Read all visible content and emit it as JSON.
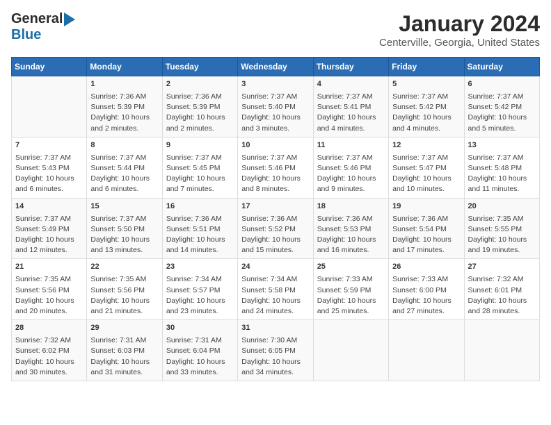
{
  "logo": {
    "general": "General",
    "blue": "Blue"
  },
  "title": "January 2024",
  "subtitle": "Centerville, Georgia, United States",
  "days_of_week": [
    "Sunday",
    "Monday",
    "Tuesday",
    "Wednesday",
    "Thursday",
    "Friday",
    "Saturday"
  ],
  "weeks": [
    [
      {
        "day": "",
        "content": ""
      },
      {
        "day": "1",
        "content": "Sunrise: 7:36 AM\nSunset: 5:39 PM\nDaylight: 10 hours\nand 2 minutes."
      },
      {
        "day": "2",
        "content": "Sunrise: 7:36 AM\nSunset: 5:39 PM\nDaylight: 10 hours\nand 2 minutes."
      },
      {
        "day": "3",
        "content": "Sunrise: 7:37 AM\nSunset: 5:40 PM\nDaylight: 10 hours\nand 3 minutes."
      },
      {
        "day": "4",
        "content": "Sunrise: 7:37 AM\nSunset: 5:41 PM\nDaylight: 10 hours\nand 4 minutes."
      },
      {
        "day": "5",
        "content": "Sunrise: 7:37 AM\nSunset: 5:42 PM\nDaylight: 10 hours\nand 4 minutes."
      },
      {
        "day": "6",
        "content": "Sunrise: 7:37 AM\nSunset: 5:42 PM\nDaylight: 10 hours\nand 5 minutes."
      }
    ],
    [
      {
        "day": "7",
        "content": "Sunrise: 7:37 AM\nSunset: 5:43 PM\nDaylight: 10 hours\nand 6 minutes."
      },
      {
        "day": "8",
        "content": "Sunrise: 7:37 AM\nSunset: 5:44 PM\nDaylight: 10 hours\nand 6 minutes."
      },
      {
        "day": "9",
        "content": "Sunrise: 7:37 AM\nSunset: 5:45 PM\nDaylight: 10 hours\nand 7 minutes."
      },
      {
        "day": "10",
        "content": "Sunrise: 7:37 AM\nSunset: 5:46 PM\nDaylight: 10 hours\nand 8 minutes."
      },
      {
        "day": "11",
        "content": "Sunrise: 7:37 AM\nSunset: 5:46 PM\nDaylight: 10 hours\nand 9 minutes."
      },
      {
        "day": "12",
        "content": "Sunrise: 7:37 AM\nSunset: 5:47 PM\nDaylight: 10 hours\nand 10 minutes."
      },
      {
        "day": "13",
        "content": "Sunrise: 7:37 AM\nSunset: 5:48 PM\nDaylight: 10 hours\nand 11 minutes."
      }
    ],
    [
      {
        "day": "14",
        "content": "Sunrise: 7:37 AM\nSunset: 5:49 PM\nDaylight: 10 hours\nand 12 minutes."
      },
      {
        "day": "15",
        "content": "Sunrise: 7:37 AM\nSunset: 5:50 PM\nDaylight: 10 hours\nand 13 minutes."
      },
      {
        "day": "16",
        "content": "Sunrise: 7:36 AM\nSunset: 5:51 PM\nDaylight: 10 hours\nand 14 minutes."
      },
      {
        "day": "17",
        "content": "Sunrise: 7:36 AM\nSunset: 5:52 PM\nDaylight: 10 hours\nand 15 minutes."
      },
      {
        "day": "18",
        "content": "Sunrise: 7:36 AM\nSunset: 5:53 PM\nDaylight: 10 hours\nand 16 minutes."
      },
      {
        "day": "19",
        "content": "Sunrise: 7:36 AM\nSunset: 5:54 PM\nDaylight: 10 hours\nand 17 minutes."
      },
      {
        "day": "20",
        "content": "Sunrise: 7:35 AM\nSunset: 5:55 PM\nDaylight: 10 hours\nand 19 minutes."
      }
    ],
    [
      {
        "day": "21",
        "content": "Sunrise: 7:35 AM\nSunset: 5:56 PM\nDaylight: 10 hours\nand 20 minutes."
      },
      {
        "day": "22",
        "content": "Sunrise: 7:35 AM\nSunset: 5:56 PM\nDaylight: 10 hours\nand 21 minutes."
      },
      {
        "day": "23",
        "content": "Sunrise: 7:34 AM\nSunset: 5:57 PM\nDaylight: 10 hours\nand 23 minutes."
      },
      {
        "day": "24",
        "content": "Sunrise: 7:34 AM\nSunset: 5:58 PM\nDaylight: 10 hours\nand 24 minutes."
      },
      {
        "day": "25",
        "content": "Sunrise: 7:33 AM\nSunset: 5:59 PM\nDaylight: 10 hours\nand 25 minutes."
      },
      {
        "day": "26",
        "content": "Sunrise: 7:33 AM\nSunset: 6:00 PM\nDaylight: 10 hours\nand 27 minutes."
      },
      {
        "day": "27",
        "content": "Sunrise: 7:32 AM\nSunset: 6:01 PM\nDaylight: 10 hours\nand 28 minutes."
      }
    ],
    [
      {
        "day": "28",
        "content": "Sunrise: 7:32 AM\nSunset: 6:02 PM\nDaylight: 10 hours\nand 30 minutes."
      },
      {
        "day": "29",
        "content": "Sunrise: 7:31 AM\nSunset: 6:03 PM\nDaylight: 10 hours\nand 31 minutes."
      },
      {
        "day": "30",
        "content": "Sunrise: 7:31 AM\nSunset: 6:04 PM\nDaylight: 10 hours\nand 33 minutes."
      },
      {
        "day": "31",
        "content": "Sunrise: 7:30 AM\nSunset: 6:05 PM\nDaylight: 10 hours\nand 34 minutes."
      },
      {
        "day": "",
        "content": ""
      },
      {
        "day": "",
        "content": ""
      },
      {
        "day": "",
        "content": ""
      }
    ]
  ]
}
